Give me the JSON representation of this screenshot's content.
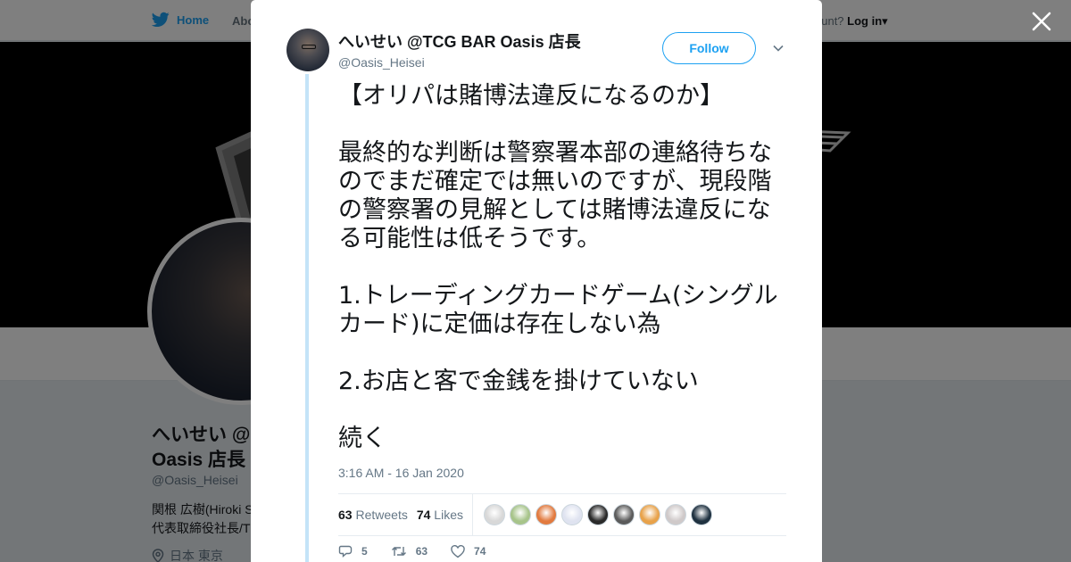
{
  "nav": {
    "home_label": "Home",
    "about_label": "Abo",
    "account_prompt": "ccount?",
    "login_label": "Log in"
  },
  "profile": {
    "name": "へいせい @TCG BAR Oasis 店長",
    "name_visible": "へいせい @",
    "name_line2": "Oasis 店長",
    "handle": "@Oasis_Heisei",
    "bio_line1": "関根 広樹(Hiroki S",
    "bio_line2": "代表取締役社長/T",
    "location": "日本 東京"
  },
  "tweet": {
    "author_name": "へいせい @TCG BAR Oasis 店長",
    "author_handle": "@Oasis_Heisei",
    "follow_label": "Follow",
    "paragraphs": [
      "【オリパは賭博法違反になるのか】",
      "最終的な判断は警察署本部の連絡待ちなのでまだ確定では無いのですが、現段階の警察署の見解としては賭博法違反になる可能性は低そうです。",
      "1.トレーディングカードゲーム(シングルカード)に定価は存在しない為",
      "2.お店と客で金銭を掛けていない",
      "続く"
    ],
    "timestamp": "3:16 AM - 16 Jan 2020",
    "retweets_count": "63",
    "retweets_label": "Retweets",
    "likes_count": "74",
    "likes_label": "Likes",
    "reply_count": "5",
    "retweet_action_count": "63",
    "like_action_count": "74"
  },
  "liker_avatar_colors": [
    "#d8d8d8",
    "#a7c48a",
    "#e27a3f",
    "#dfe3f0",
    "#2a2a2a",
    "#5b5b5b",
    "#e8a24a",
    "#cfc9c9",
    "#1f3140"
  ],
  "colors": {
    "accent": "#1da1f2",
    "thread_line": "#c4e4f8",
    "text": "#14171a",
    "muted": "#657786"
  }
}
